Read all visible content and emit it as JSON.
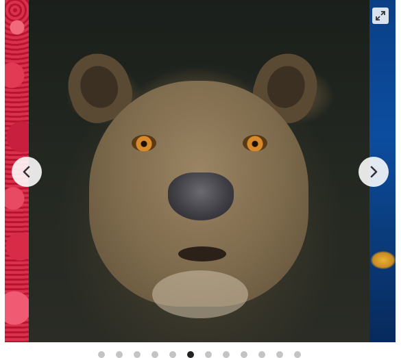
{
  "carousel": {
    "slides": [
      {
        "subject": "strawberries",
        "state": "previous"
      },
      {
        "subject": "lioness",
        "state": "current"
      },
      {
        "subject": "jellyfish",
        "state": "next"
      }
    ],
    "prev_icon": "chevron-left-icon",
    "next_icon": "chevron-right-icon",
    "fullscreen_icon": "expand-icon",
    "dot_count": 12,
    "active_dot_index": 5
  },
  "colors": {
    "button_bg": "#ffffff",
    "dot_inactive": "#c4c4c4",
    "dot_active": "#222222"
  }
}
